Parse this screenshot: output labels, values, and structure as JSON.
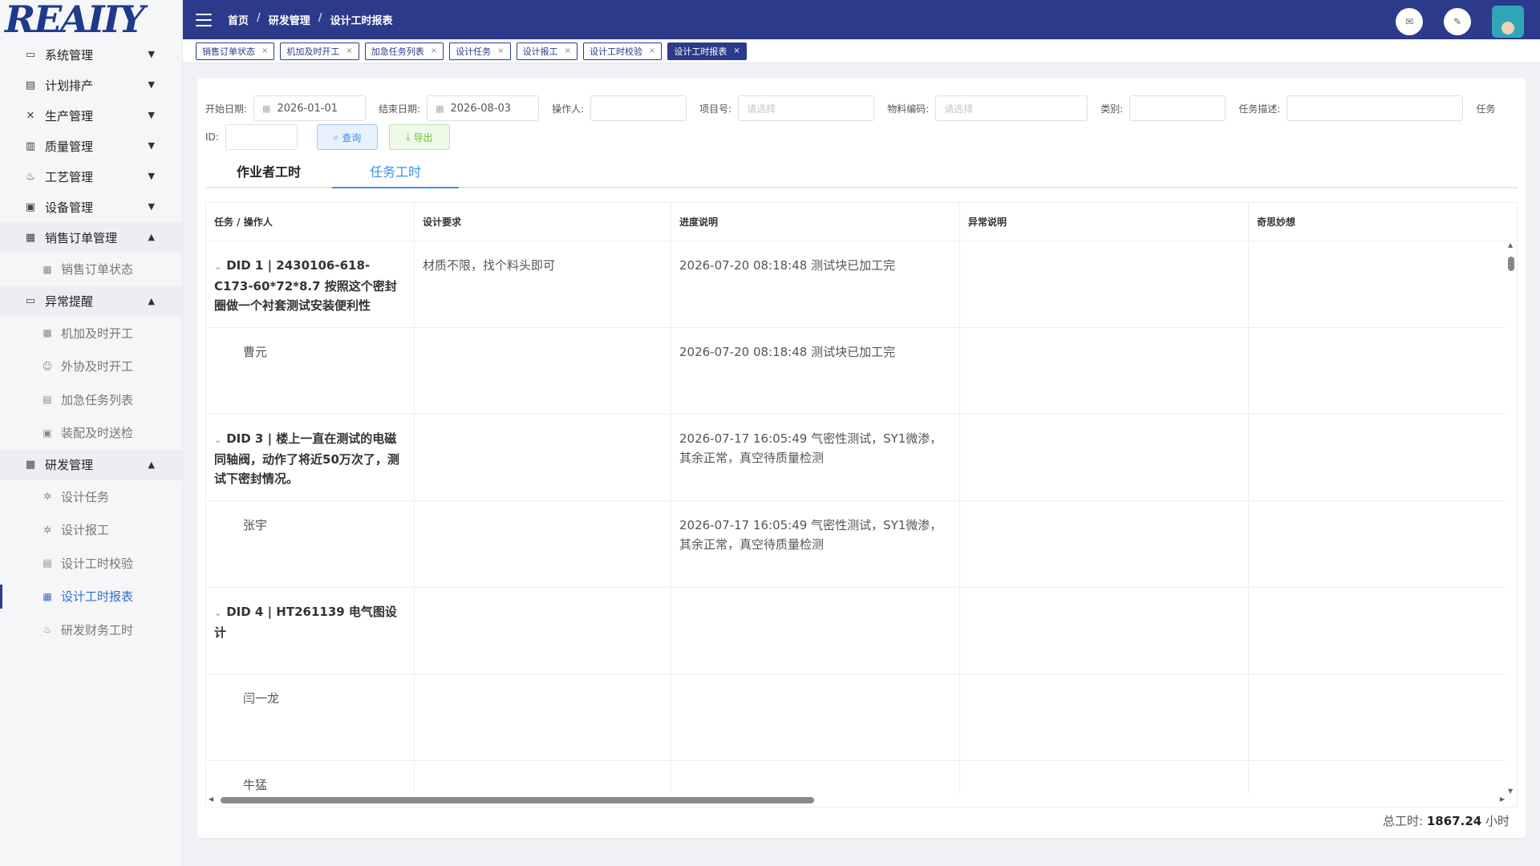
{
  "logo": {
    "text": "REAIIY"
  },
  "sidebar": {
    "groups": [
      {
        "label": "系统管理",
        "icon": "monitor-icon",
        "expanded": false,
        "items": []
      },
      {
        "label": "计划排产",
        "icon": "plan-icon",
        "expanded": false,
        "items": []
      },
      {
        "label": "生产管理",
        "icon": "tools-icon",
        "expanded": false,
        "items": []
      },
      {
        "label": "质量管理",
        "icon": "document-icon",
        "expanded": false,
        "items": []
      },
      {
        "label": "工艺管理",
        "icon": "process-icon",
        "expanded": false,
        "items": []
      },
      {
        "label": "设备管理",
        "icon": "device-icon",
        "expanded": false,
        "items": []
      },
      {
        "label": "销售订单管理",
        "icon": "order-icon",
        "expanded": true,
        "items": [
          {
            "label": "销售订单状态",
            "icon": "table-icon"
          }
        ]
      },
      {
        "label": "异常提醒",
        "icon": "monitor-icon",
        "expanded": true,
        "items": [
          {
            "label": "机加及时开工",
            "icon": "calendar-icon"
          },
          {
            "label": "外协及时开工",
            "icon": "user-icon"
          },
          {
            "label": "加急任务列表",
            "icon": "list-icon"
          },
          {
            "label": "装配及时送检",
            "icon": "check-icon"
          }
        ]
      },
      {
        "label": "研发管理",
        "icon": "calendar-icon",
        "expanded": true,
        "items": [
          {
            "label": "设计任务",
            "icon": "gear-icon"
          },
          {
            "label": "设计报工",
            "icon": "gear-icon"
          },
          {
            "label": "设计工时校验",
            "icon": "doc-check-icon"
          },
          {
            "label": "设计工时报表",
            "icon": "report-icon",
            "active": true
          },
          {
            "label": "研发财务工时",
            "icon": "finance-icon"
          }
        ]
      }
    ]
  },
  "header": {
    "breadcrumb": [
      "首页",
      "研发管理",
      "设计工时报表"
    ]
  },
  "tags": [
    {
      "label": "销售订单状态",
      "active": false
    },
    {
      "label": "机加及时开工",
      "active": false
    },
    {
      "label": "加急任务列表",
      "active": false
    },
    {
      "label": "设计任务",
      "active": false
    },
    {
      "label": "设计报工",
      "active": false
    },
    {
      "label": "设计工时校验",
      "active": false
    },
    {
      "label": "设计工时报表",
      "active": true
    }
  ],
  "filters": {
    "start_label": "开始日期:",
    "start_value": "2026-01-01",
    "end_label": "结束日期:",
    "end_value": "2026-08-03",
    "operator_label": "操作人:",
    "operator_value": "",
    "project_label": "项目号:",
    "project_placeholder": "请选择",
    "material_label": "物料编码:",
    "material_placeholder": "请选择",
    "category_label": "类别:",
    "category_value": "",
    "desc_label": "任务描述:",
    "desc_value": "",
    "taskid_label_1": "任务",
    "taskid_label_2": "ID:",
    "taskid_value": "",
    "query_label": "查询",
    "export_label": "导出"
  },
  "tabs": [
    {
      "label": "作业者工时",
      "active": false
    },
    {
      "label": "任务工时",
      "active": true
    }
  ],
  "table": {
    "columns": [
      "任务 / 操作人",
      "设计要求",
      "进度说明",
      "异常说明",
      "奇思妙想"
    ],
    "rows": [
      {
        "type": "task",
        "task": "DID 1 | 2430106-618-C173-60*72*8.7 按照这个密封圈做一个衬套测试安装便利性",
        "requirement": "材质不限，找个料头即可",
        "progress": "2026-07-20 08:18:48 测试块已加工完",
        "exception": "",
        "idea": ""
      },
      {
        "type": "operator",
        "task": "曹元",
        "requirement": "",
        "progress": "2026-07-20 08:18:48 测试块已加工完",
        "exception": "",
        "idea": ""
      },
      {
        "type": "task",
        "task": "DID 3 | 楼上一直在测试的电磁同轴阀，动作了将近50万次了，测试下密封情况。",
        "requirement": "",
        "progress": "2026-07-17 16:05:49 气密性测试，SY1微渗，其余正常，真空待质量检测",
        "exception": "",
        "idea": ""
      },
      {
        "type": "operator",
        "task": "张宇",
        "requirement": "",
        "progress": "2026-07-17 16:05:49 气密性测试，SY1微渗，其余正常，真空待质量检测",
        "exception": "",
        "idea": ""
      },
      {
        "type": "task",
        "task": "DID 4 | HT261139 电气图设计",
        "requirement": "",
        "progress": "",
        "exception": "",
        "idea": ""
      },
      {
        "type": "operator",
        "task": "闫一龙",
        "requirement": "",
        "progress": "",
        "exception": "",
        "idea": ""
      },
      {
        "type": "operator",
        "task": "牛猛",
        "requirement": "",
        "progress": "",
        "exception": "",
        "idea": ""
      }
    ]
  },
  "total": {
    "label": "总工时:",
    "value": "1867.24",
    "unit": "小时"
  },
  "colors": {
    "header_bg": "#2b3a8a",
    "accent": "#3d8ef5",
    "export_green": "#67c23a"
  }
}
